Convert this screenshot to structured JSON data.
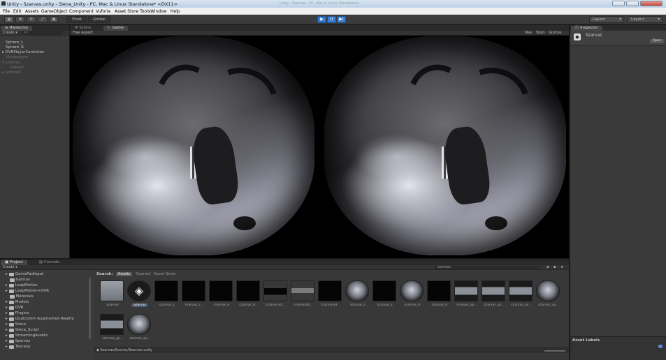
{
  "window": {
    "title": "Unity - Szarvas.unity - Siena_Unity - PC, Mac & Linux Standalone* <DX11>",
    "center_label": "Unity - Szarvas - PC, Mac & Linux Standalone"
  },
  "menu": [
    "File",
    "Edit",
    "Assets",
    "GameObject",
    "Component",
    "Vuforia",
    "Asset Store Tools",
    "Window",
    "Help"
  ],
  "toolbar": {
    "pivot": "Pivot",
    "global": "Global",
    "play": "▶",
    "pause": "II",
    "step": "▶I",
    "layers": "Layers",
    "layout": "Layout"
  },
  "hierarchy": {
    "tab": "Hierarchy",
    "create": "Create",
    "search_placeholder": "All",
    "items": [
      "Sphere_L",
      "Sphere_R",
      "OVRPlayerController",
      "Videoplayer",
      "sphereL",
      "Default",
      "sphereR"
    ]
  },
  "scene_tabs": {
    "scene": "Scene",
    "game": "Game",
    "aspect": "Free Aspect",
    "stats": "Stats",
    "gizmos": "Gizmos",
    "maximize": "Max"
  },
  "inspector": {
    "tab": "Inspector",
    "object_name": "Szarvas",
    "open_button": "Open",
    "asset_labels": "Asset Labels"
  },
  "project": {
    "tab": "Project",
    "console_tab": "Console",
    "create": "Create",
    "search_value": "szarvas",
    "search_label": "Search:",
    "scopes": [
      "Assets",
      "'Scenes'",
      "Asset Store"
    ],
    "folders": [
      "GamePadInput",
      "Gizmos",
      "LeapMotion",
      "LeapMotion+OVR",
      "Materials",
      "Models",
      "OVR",
      "Plugins",
      "Qualcomm Augmented Reality",
      "Siena",
      "Siena_Script",
      "StreamingAssets",
      "Szarvas",
      "Toscany"
    ],
    "assets": [
      {
        "label": "Szarvas",
        "kind": "folder"
      },
      {
        "label": "Szarvas",
        "kind": "unity"
      },
      {
        "label": "szarvas_L",
        "kind": "black"
      },
      {
        "label": "szarvas_L...",
        "kind": "black"
      },
      {
        "label": "szarvas_R",
        "kind": "black"
      },
      {
        "label": "szarvas_R...",
        "kind": "black"
      },
      {
        "label": "szarvas3d_...",
        "kind": "thin"
      },
      {
        "label": "szarvas00...",
        "kind": "grey"
      },
      {
        "label": "szarvas3d...",
        "kind": "black"
      },
      {
        "label": "Szarvas_L",
        "kind": "sphere"
      },
      {
        "label": "szarvas_L",
        "kind": "black"
      },
      {
        "label": "Szarvas_R",
        "kind": "sphere"
      },
      {
        "label": "szarvas_R",
        "kind": "black"
      },
      {
        "label": "szarvas_sp...",
        "kind": "flat"
      },
      {
        "label": "szarvas_sp...",
        "kind": "flat"
      },
      {
        "label": "szarvas_sp...",
        "kind": "flat"
      },
      {
        "label": "szarvas_sp...",
        "kind": "sphere"
      },
      {
        "label": "szarvas_sp...",
        "kind": "flat"
      },
      {
        "label": "szarvas_sp...",
        "kind": "sphere"
      }
    ],
    "path": "Szarvas/Scenes/Szarvas.unity"
  }
}
